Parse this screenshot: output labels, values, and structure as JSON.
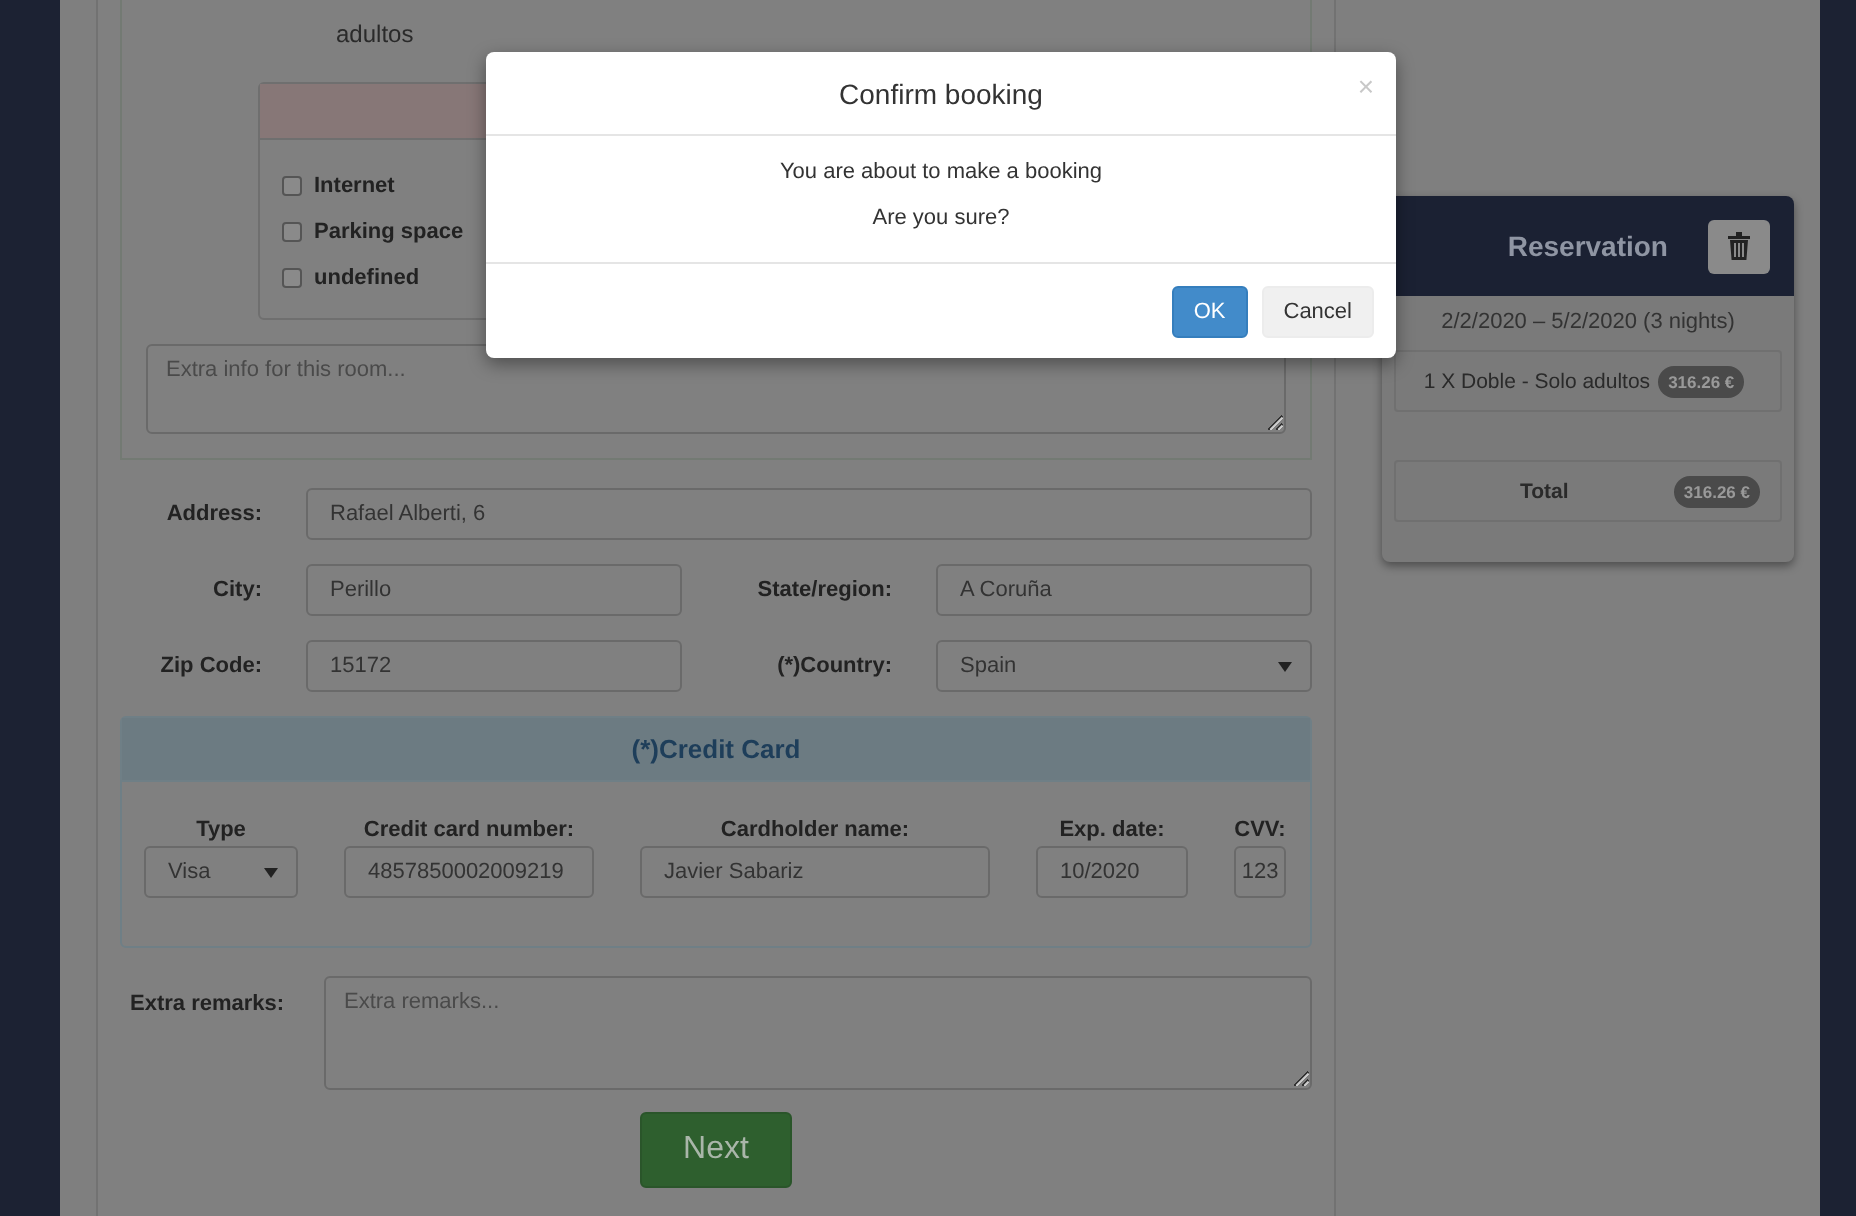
{
  "room": {
    "occupancy_text": "adultos",
    "amenities": [
      {
        "label": "Internet",
        "checked": false
      },
      {
        "label": "Parking space",
        "checked": false
      },
      {
        "label": "undefined",
        "checked": false
      }
    ],
    "extra_info": {
      "placeholder": "Extra info for this room..."
    }
  },
  "address": {
    "rows": [
      {
        "fields": [
          {
            "label": "Address:",
            "value": "Rafael Alberti, 6",
            "kind": "input"
          }
        ]
      },
      {
        "fields": [
          {
            "label": "City:",
            "value": "Perillo",
            "kind": "input"
          },
          {
            "label": "State/region:",
            "value": "A Coruña",
            "kind": "input"
          }
        ]
      },
      {
        "fields": [
          {
            "label": "Zip Code:",
            "value": "15172",
            "kind": "input"
          },
          {
            "label": "(*)Country:",
            "value": "Spain",
            "kind": "select"
          }
        ]
      }
    ]
  },
  "credit_card": {
    "title": "(*)Credit Card",
    "fields": [
      {
        "label": "Type",
        "value": "Visa",
        "kind": "select"
      },
      {
        "label": "Credit card number:",
        "value": "4857850002009219",
        "kind": "input"
      },
      {
        "label": "Cardholder name:",
        "value": "Javier Sabariz",
        "kind": "input"
      },
      {
        "label": "Exp. date:",
        "value": "10/2020",
        "kind": "input"
      },
      {
        "label": "CVV:",
        "value": "123",
        "kind": "input"
      }
    ]
  },
  "extra_remarks": {
    "label": "Extra remarks:",
    "placeholder": "Extra remarks..."
  },
  "next_button": {
    "label": "Next"
  },
  "reservation": {
    "title": "Reservation",
    "dates": "2/2/2020 – 5/2/2020 (3 nights)",
    "items": [
      {
        "label": "1 X Doble - Solo adultos",
        "price": "316.26 €"
      }
    ],
    "total": {
      "label": "Total",
      "price": "316.26 €"
    }
  },
  "modal": {
    "title": "Confirm booking",
    "close": "×",
    "lines": [
      "You are about to make a booking",
      "Are you sure?"
    ],
    "buttons": [
      {
        "label": "OK",
        "kind": "primary"
      },
      {
        "label": "Cancel",
        "kind": "default"
      }
    ]
  }
}
